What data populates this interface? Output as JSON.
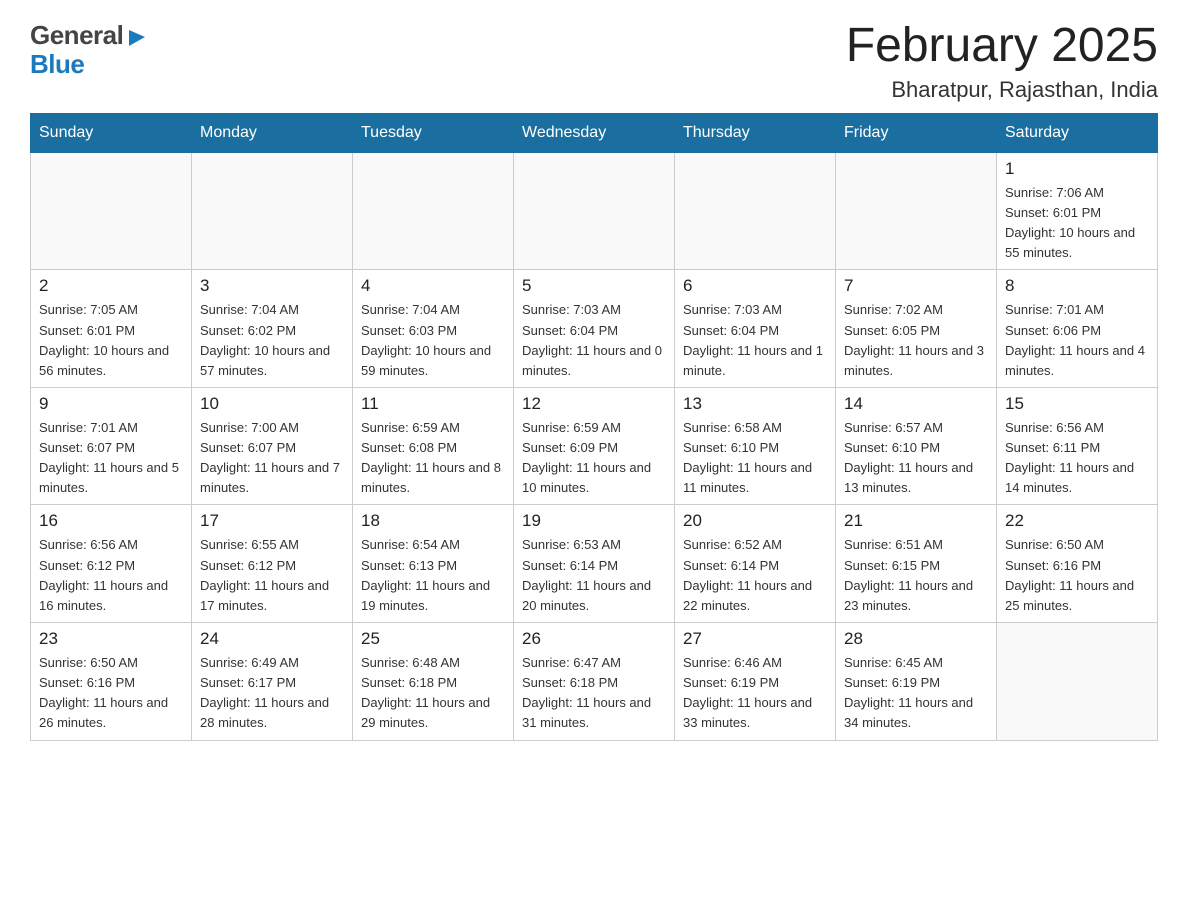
{
  "header": {
    "title": "February 2025",
    "location": "Bharatpur, Rajasthan, India",
    "logo_general": "General",
    "logo_blue": "Blue"
  },
  "days_of_week": [
    "Sunday",
    "Monday",
    "Tuesday",
    "Wednesday",
    "Thursday",
    "Friday",
    "Saturday"
  ],
  "weeks": [
    [
      {
        "day": "",
        "info": ""
      },
      {
        "day": "",
        "info": ""
      },
      {
        "day": "",
        "info": ""
      },
      {
        "day": "",
        "info": ""
      },
      {
        "day": "",
        "info": ""
      },
      {
        "day": "",
        "info": ""
      },
      {
        "day": "1",
        "info": "Sunrise: 7:06 AM\nSunset: 6:01 PM\nDaylight: 10 hours\nand 55 minutes."
      }
    ],
    [
      {
        "day": "2",
        "info": "Sunrise: 7:05 AM\nSunset: 6:01 PM\nDaylight: 10 hours\nand 56 minutes."
      },
      {
        "day": "3",
        "info": "Sunrise: 7:04 AM\nSunset: 6:02 PM\nDaylight: 10 hours\nand 57 minutes."
      },
      {
        "day": "4",
        "info": "Sunrise: 7:04 AM\nSunset: 6:03 PM\nDaylight: 10 hours\nand 59 minutes."
      },
      {
        "day": "5",
        "info": "Sunrise: 7:03 AM\nSunset: 6:04 PM\nDaylight: 11 hours\nand 0 minutes."
      },
      {
        "day": "6",
        "info": "Sunrise: 7:03 AM\nSunset: 6:04 PM\nDaylight: 11 hours\nand 1 minute."
      },
      {
        "day": "7",
        "info": "Sunrise: 7:02 AM\nSunset: 6:05 PM\nDaylight: 11 hours\nand 3 minutes."
      },
      {
        "day": "8",
        "info": "Sunrise: 7:01 AM\nSunset: 6:06 PM\nDaylight: 11 hours\nand 4 minutes."
      }
    ],
    [
      {
        "day": "9",
        "info": "Sunrise: 7:01 AM\nSunset: 6:07 PM\nDaylight: 11 hours\nand 5 minutes."
      },
      {
        "day": "10",
        "info": "Sunrise: 7:00 AM\nSunset: 6:07 PM\nDaylight: 11 hours\nand 7 minutes."
      },
      {
        "day": "11",
        "info": "Sunrise: 6:59 AM\nSunset: 6:08 PM\nDaylight: 11 hours\nand 8 minutes."
      },
      {
        "day": "12",
        "info": "Sunrise: 6:59 AM\nSunset: 6:09 PM\nDaylight: 11 hours\nand 10 minutes."
      },
      {
        "day": "13",
        "info": "Sunrise: 6:58 AM\nSunset: 6:10 PM\nDaylight: 11 hours\nand 11 minutes."
      },
      {
        "day": "14",
        "info": "Sunrise: 6:57 AM\nSunset: 6:10 PM\nDaylight: 11 hours\nand 13 minutes."
      },
      {
        "day": "15",
        "info": "Sunrise: 6:56 AM\nSunset: 6:11 PM\nDaylight: 11 hours\nand 14 minutes."
      }
    ],
    [
      {
        "day": "16",
        "info": "Sunrise: 6:56 AM\nSunset: 6:12 PM\nDaylight: 11 hours\nand 16 minutes."
      },
      {
        "day": "17",
        "info": "Sunrise: 6:55 AM\nSunset: 6:12 PM\nDaylight: 11 hours\nand 17 minutes."
      },
      {
        "day": "18",
        "info": "Sunrise: 6:54 AM\nSunset: 6:13 PM\nDaylight: 11 hours\nand 19 minutes."
      },
      {
        "day": "19",
        "info": "Sunrise: 6:53 AM\nSunset: 6:14 PM\nDaylight: 11 hours\nand 20 minutes."
      },
      {
        "day": "20",
        "info": "Sunrise: 6:52 AM\nSunset: 6:14 PM\nDaylight: 11 hours\nand 22 minutes."
      },
      {
        "day": "21",
        "info": "Sunrise: 6:51 AM\nSunset: 6:15 PM\nDaylight: 11 hours\nand 23 minutes."
      },
      {
        "day": "22",
        "info": "Sunrise: 6:50 AM\nSunset: 6:16 PM\nDaylight: 11 hours\nand 25 minutes."
      }
    ],
    [
      {
        "day": "23",
        "info": "Sunrise: 6:50 AM\nSunset: 6:16 PM\nDaylight: 11 hours\nand 26 minutes."
      },
      {
        "day": "24",
        "info": "Sunrise: 6:49 AM\nSunset: 6:17 PM\nDaylight: 11 hours\nand 28 minutes."
      },
      {
        "day": "25",
        "info": "Sunrise: 6:48 AM\nSunset: 6:18 PM\nDaylight: 11 hours\nand 29 minutes."
      },
      {
        "day": "26",
        "info": "Sunrise: 6:47 AM\nSunset: 6:18 PM\nDaylight: 11 hours\nand 31 minutes."
      },
      {
        "day": "27",
        "info": "Sunrise: 6:46 AM\nSunset: 6:19 PM\nDaylight: 11 hours\nand 33 minutes."
      },
      {
        "day": "28",
        "info": "Sunrise: 6:45 AM\nSunset: 6:19 PM\nDaylight: 11 hours\nand 34 minutes."
      },
      {
        "day": "",
        "info": ""
      }
    ]
  ]
}
